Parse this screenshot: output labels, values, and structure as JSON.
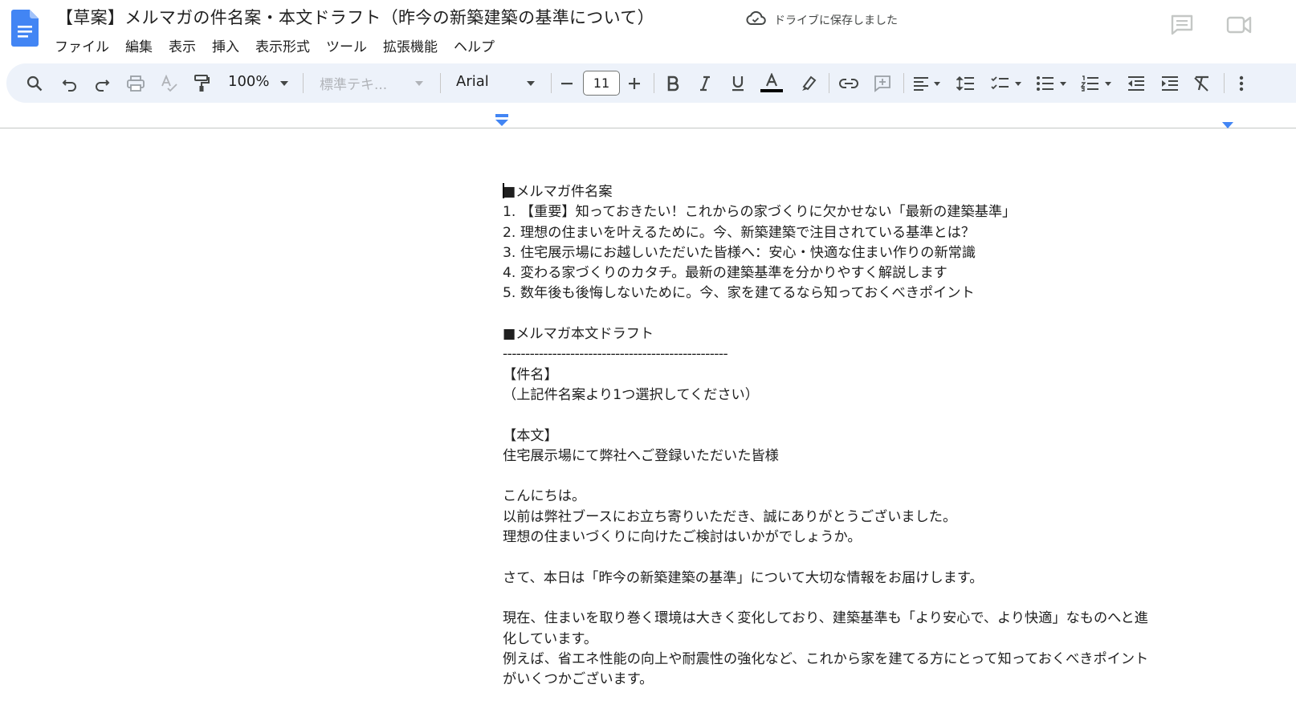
{
  "app": {
    "title": "【草案】メルマガの件名案・本文ドラフト（昨今の新築建築の基準について）",
    "save_status": "ドライブに保存しました",
    "logo_icon": "google-docs-icon",
    "brand_color": "#4285f4"
  },
  "menu": {
    "items": [
      {
        "label": "ファイル"
      },
      {
        "label": "編集"
      },
      {
        "label": "表示"
      },
      {
        "label": "挿入"
      },
      {
        "label": "表示形式"
      },
      {
        "label": "ツール"
      },
      {
        "label": "拡張機能"
      },
      {
        "label": "ヘルプ"
      }
    ]
  },
  "toolbar": {
    "zoom": "100%",
    "paragraph_style": "標準テキ...",
    "font": "Arial",
    "font_size": "11",
    "background_color": "#edf2fa",
    "text_color_swatch": "#000000",
    "icons": [
      "search-icon",
      "undo-icon",
      "redo-icon",
      "print-icon",
      "spellcheck-icon",
      "paint-format-icon",
      "zoom-dropdown-icon",
      "style-dropdown-icon",
      "font-dropdown-icon",
      "decrease-font-size-icon",
      "increase-font-size-icon",
      "bold-icon",
      "italic-icon",
      "underline-icon",
      "text-color-icon",
      "highlight-icon",
      "link-icon",
      "add-comment-icon",
      "align-icon",
      "line-spacing-icon",
      "checklist-icon",
      "bulleted-list-icon",
      "numbered-list-icon",
      "decrease-indent-icon",
      "increase-indent-icon",
      "clear-formatting-icon",
      "more-icon"
    ]
  },
  "document": {
    "lines": [
      "■メルマガ件名案",
      "1. 【重要】知っておきたい！これからの家づくりに欠かせない「最新の建築基準」",
      "2. 理想の住まいを叶えるために。今、新築建築で注目されている基準とは？",
      "3. 住宅展示場にお越しいただいた皆様へ：安心・快適な住まい作りの新常識",
      "4. 変わる家づくりのカタチ。最新の建築基準を分かりやすく解説します",
      "5. 数年後も後悔しないために。今、家を建てるなら知っておくべきポイント",
      "",
      "■メルマガ本文ドラフト",
      "--------------------------------------------------",
      "【件名】",
      "（上記件名案より1つ選択してください）",
      "",
      "【本文】",
      "住宅展示場にて弊社へご登録いただいた皆様",
      "",
      "こんにちは。",
      "以前は弊社ブースにお立ち寄りいただき、誠にありがとうございました。",
      "理想の住まいづくりに向けたご検討はいかがでしょうか。",
      "",
      "さて、本日は「昨今の新築建築の基準」について大切な情報をお届けします。",
      "",
      "現在、住まいを取り巻く環境は大きく変化しており、建築基準も「より安心で、より快適」なものへと進",
      "化しています。",
      "例えば、省エネ性能の向上や耐震性の強化など、これから家を建てる方にとって知っておくべきポイント",
      "がいくつかございます。"
    ]
  }
}
